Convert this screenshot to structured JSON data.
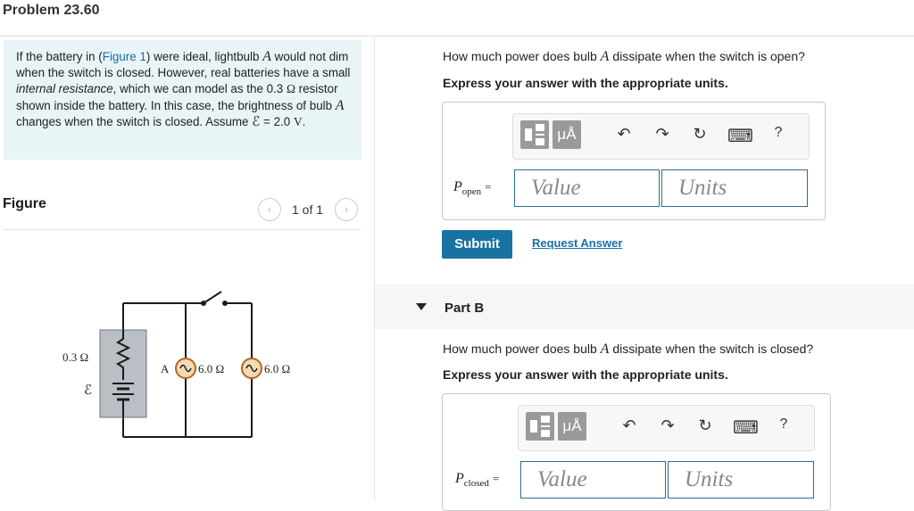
{
  "header": {
    "title": "Problem 23.60"
  },
  "problem": {
    "text_before_link": "If the battery in (",
    "link": "Figure 1",
    "text_1": ") were ideal, lightbulb ",
    "bulb_a": "A",
    "text_2": " would not dim when the switch is closed. However, real batteries have a small ",
    "italic_term": "internal resistance",
    "text_3": ", which we can model as the 0.3 ",
    "ohm": "Ω",
    "text_4": " resistor shown inside the battery. In this case, the brightness of bulb ",
    "bulb_a2": "A",
    "text_5": " changes when the switch is closed. Assume ",
    "emf": "ℰ",
    "text_6": " = 2.0 ",
    "volt": "V",
    "text_7": "."
  },
  "figure": {
    "label": "Figure",
    "pager": "1 of 1",
    "prev_icon": "‹",
    "next_icon": "›",
    "circuit": {
      "battery_r": "0.3 Ω",
      "emf": "ℰ",
      "bulb_a_label": "A",
      "bulb_a_r": "6.0 Ω",
      "bulb_b_r": "6.0 Ω"
    }
  },
  "part_a": {
    "question_1": "How much power does bulb ",
    "bulb": "A",
    "question_2": " dissipate when the switch is open?",
    "instruction": "Express your answer with the appropriate units.",
    "var_main": "P",
    "var_sub": "open",
    "equals": "=",
    "value_placeholder": "Value",
    "units_placeholder": "Units",
    "submit": "Submit",
    "request_answer": "Request Answer",
    "toolbar": {
      "units_btn": "μÅ",
      "undo": "↶",
      "redo": "↷",
      "reset": "↻",
      "keyboard": "⌨",
      "help": "?"
    }
  },
  "part_b": {
    "label": "Part B",
    "question_1": "How much power does bulb ",
    "bulb": "A",
    "question_2": " dissipate when the switch is closed?",
    "instruction": "Express your answer with the appropriate units.",
    "var_main": "P",
    "var_sub": "closed",
    "equals": "=",
    "value_placeholder": "Value",
    "units_placeholder": "Units",
    "toolbar": {
      "units_btn": "μÅ",
      "undo": "↶",
      "redo": "↷",
      "reset": "↻",
      "keyboard": "⌨",
      "help": "?"
    }
  }
}
